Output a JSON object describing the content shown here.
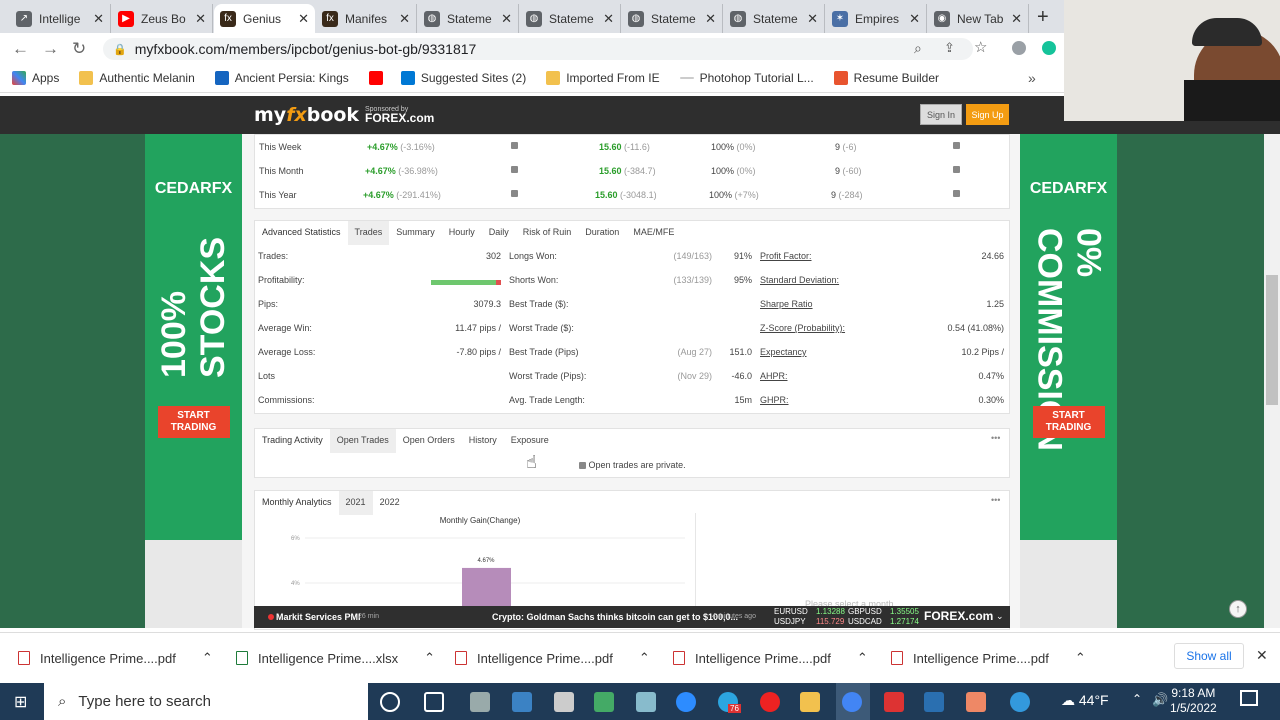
{
  "browser": {
    "tabs": [
      {
        "title": "Intellige",
        "icon": "chart-icon",
        "color": "#5f6368",
        "active": false
      },
      {
        "title": "Zeus Bo",
        "icon": "youtube-icon",
        "color": "#ff0000",
        "active": false
      },
      {
        "title": "Genius",
        "icon": "myfxbook-icon",
        "color": "#3a2a1a",
        "active": true
      },
      {
        "title": "Manifes",
        "icon": "myfxbook-icon",
        "color": "#3a2a1a",
        "active": false
      },
      {
        "title": "Stateme",
        "icon": "globe-icon",
        "color": "#5f6368",
        "active": false
      },
      {
        "title": "Stateme",
        "icon": "globe-icon",
        "color": "#5f6368",
        "active": false
      },
      {
        "title": "Stateme",
        "icon": "globe-icon",
        "color": "#5f6368",
        "active": false
      },
      {
        "title": "Stateme",
        "icon": "globe-icon",
        "color": "#5f6368",
        "active": false
      },
      {
        "title": "Empires",
        "icon": "empires-icon",
        "color": "#4a6fa5",
        "active": false
      },
      {
        "title": "New Tab",
        "icon": "chrome-icon",
        "color": "#5f6368",
        "active": false
      }
    ],
    "url": "myfxbook.com/members/ipcbot/genius-bot-gb/9331817",
    "bookmarks": [
      "Apps",
      "Authentic Melanin",
      "Ancient Persia: Kings",
      "",
      "Suggested Sites (2)",
      "Imported From IE",
      "Photohop Tutorial L...",
      "Resume Builder"
    ],
    "bookmarks_more": "»"
  },
  "site": {
    "logo_my": "my",
    "logo_fx": "fx",
    "logo_book": "book",
    "sponsored": "Sponsored by",
    "sponsor": "FOREX.com",
    "sign_in": "Sign In",
    "sign_up": "Sign Up"
  },
  "ads": {
    "left": {
      "brand": "CEDARFX",
      "big": "100% STOCKS",
      "cta": "START TRADING"
    },
    "right": {
      "brand": "CEDARFX",
      "big": "0% COMMISSION",
      "cta": "START TRADING"
    }
  },
  "periods": [
    {
      "label": "This Week",
      "gain": "+4.67%",
      "gain_sub": "(-3.16%)",
      "pips": "15.60",
      "pips_sub": "(-11.6)",
      "won": "100%",
      "won_sub": "(0%)",
      "trades": "9",
      "trades_sub": "(-6)"
    },
    {
      "label": "This Month",
      "gain": "+4.67%",
      "gain_sub": "(-36.98%)",
      "pips": "15.60",
      "pips_sub": "(-384.7)",
      "won": "100%",
      "won_sub": "(0%)",
      "trades": "9",
      "trades_sub": "(-60)"
    },
    {
      "label": "This Year",
      "gain": "+4.67%",
      "gain_sub": "(-291.41%)",
      "pips": "15.60",
      "pips_sub": "(-3048.1)",
      "won": "100%",
      "won_sub": "(+7%)",
      "trades": "9",
      "trades_sub": "(-284)"
    }
  ],
  "advanced": {
    "tabs": [
      "Advanced Statistics",
      "Trades",
      "Summary",
      "Hourly",
      "Daily",
      "Risk of Ruin",
      "Duration",
      "MAE/MFE"
    ],
    "col1": [
      {
        "label": "Trades:",
        "value": "302"
      },
      {
        "label": "Profitability:",
        "value": ""
      },
      {
        "label": "Pips:",
        "value": "3079.3"
      },
      {
        "label": "Average Win:",
        "value": "11.47 pips /"
      },
      {
        "label": "Average Loss:",
        "value": "-7.80 pips /"
      },
      {
        "label": "Lots",
        "value": ""
      },
      {
        "label": "Commissions:",
        "value": ""
      }
    ],
    "col2": [
      {
        "label": "Longs Won:",
        "sub": "(149/163)",
        "value": "91%"
      },
      {
        "label": "Shorts Won:",
        "sub": "(133/139)",
        "value": "95%"
      },
      {
        "label": "Best Trade ($):",
        "sub": "",
        "value": ""
      },
      {
        "label": "Worst Trade ($):",
        "sub": "",
        "value": ""
      },
      {
        "label": "Best Trade (Pips)",
        "sub": "(Aug 27)",
        "value": "151.0"
      },
      {
        "label": "Worst Trade (Pips):",
        "sub": "(Nov 29)",
        "value": "-46.0"
      },
      {
        "label": "Avg. Trade Length:",
        "sub": "",
        "value": "15m"
      }
    ],
    "col3": [
      {
        "label": "Profit Factor:",
        "value": "24.66"
      },
      {
        "label": "Standard Deviation:",
        "value": ""
      },
      {
        "label": "Sharpe Ratio",
        "value": "1.25"
      },
      {
        "label": "Z-Score (Probability):",
        "value": "0.54 (41.08%)"
      },
      {
        "label": "Expectancy",
        "value": "10.2 Pips /"
      },
      {
        "label": "AHPR:",
        "value": "0.47%"
      },
      {
        "label": "GHPR:",
        "value": "0.30%"
      }
    ],
    "profitability": 0.93
  },
  "trading": {
    "tabs": [
      "Trading Activity",
      "Open Trades",
      "Open Orders",
      "History",
      "Exposure"
    ],
    "message": "Open trades are private.",
    "more": "•••"
  },
  "monthly": {
    "tabs": [
      "Monthly Analytics",
      "2021",
      "2022"
    ],
    "chart_title": "Monthly Gain(Change)",
    "more": "•••",
    "hint": "Please select a month"
  },
  "chart_data": {
    "type": "bar",
    "title": "Monthly Gain(Change)",
    "categories": [
      ""
    ],
    "values": [
      4.67
    ],
    "data_labels": [
      "4.67%"
    ],
    "y_ticks": [
      "6%",
      "4%"
    ],
    "ylim": [
      0,
      6
    ],
    "grid": true,
    "color": "#b68cba"
  },
  "ticker": {
    "news1": "Markit Services PMI",
    "news1_time": "26 min",
    "news2": "Crypto: Goldman Sachs thinks bitcoin can get to $100,0...",
    "news2_time": "4 minutes ago",
    "pairs": [
      {
        "name": "EURUSD",
        "value": "1.13288"
      },
      {
        "name": "USDJPY",
        "value": "115.729"
      },
      {
        "name": "GBPUSD",
        "value": "1.35505"
      },
      {
        "name": "USDCAD",
        "value": "1.27174"
      }
    ],
    "brand": "FOREX.com"
  },
  "downloads": {
    "items": [
      {
        "name": "Intelligence Prime....pdf",
        "type": "pdf"
      },
      {
        "name": "Intelligence Prime....xlsx",
        "type": "xlsx"
      },
      {
        "name": "Intelligence Prime....pdf",
        "type": "pdf"
      },
      {
        "name": "Intelligence Prime....pdf",
        "type": "pdf"
      },
      {
        "name": "Intelligence Prime....pdf",
        "type": "pdf"
      }
    ],
    "show_all": "Show all"
  },
  "taskbar": {
    "search_placeholder": "Type here to search",
    "weather": "44°F",
    "time": "9:18 AM",
    "date": "1/5/2022",
    "mail_badge": "76"
  }
}
